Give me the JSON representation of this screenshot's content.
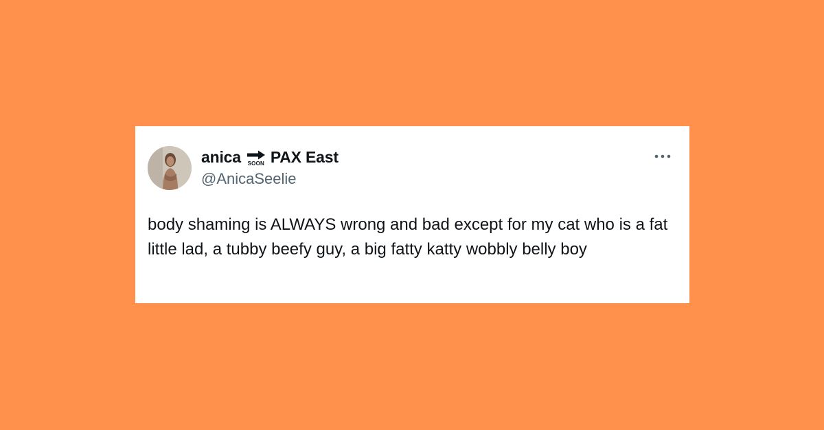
{
  "colors": {
    "background": "#FF914D",
    "card": "#FFFFFF",
    "text_primary": "#0F1419",
    "text_secondary": "#536471"
  },
  "tweet": {
    "author": {
      "display_name": "anica",
      "name_emoji": {
        "icon": "soon-arrow-icon",
        "label": "SOON"
      },
      "name_suffix": "PAX East",
      "handle": "@AnicaSeelie",
      "avatar_icon": "avatar-photo"
    },
    "more_icon": "more-options-icon",
    "text": "body shaming is ALWAYS wrong and bad except for my cat who is a fat little lad, a tubby beefy guy, a big fatty katty wobbly belly boy"
  }
}
